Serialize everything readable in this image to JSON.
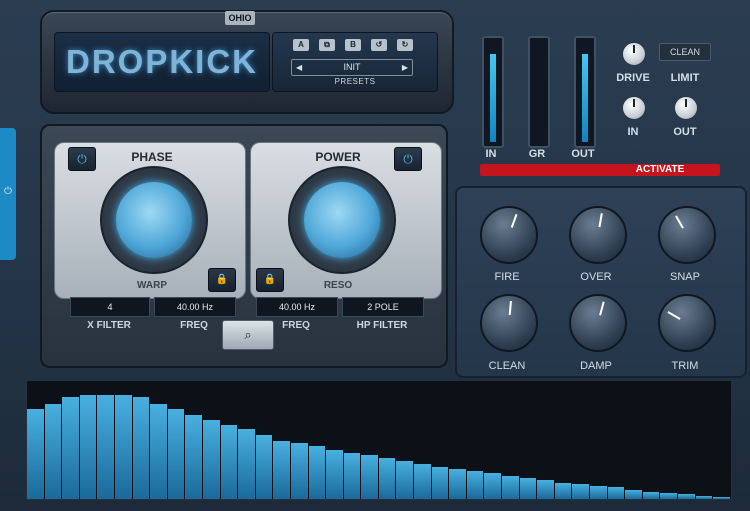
{
  "app": {
    "logo": "DROPKICK",
    "brand_badge": "OHIO"
  },
  "presets": {
    "buttons": [
      "A",
      "⧉",
      "B",
      "↺",
      "↻"
    ],
    "current": "INIT",
    "caption": "PRESETS"
  },
  "meters": [
    {
      "label": "IN",
      "level": 0.88
    },
    {
      "label": "GR",
      "level": 0.0
    },
    {
      "label": "OUT",
      "level": 0.88
    }
  ],
  "dynamics": {
    "mode": "CLEAN",
    "drive_label": "DRIVE",
    "limit_label": "LIMIT",
    "in_label": "IN",
    "out_label": "OUT"
  },
  "activate": {
    "label": "ACTIVATE",
    "color": "#c4141d"
  },
  "filters": {
    "left": {
      "title": "PHASE",
      "sub": "WARP",
      "values": [
        "4",
        "40.00 Hz"
      ],
      "labels": [
        "X FILTER",
        "FREQ"
      ]
    },
    "right": {
      "title": "POWER",
      "sub": "RESO",
      "values": [
        "40.00 Hz",
        "2 POLE"
      ],
      "labels": [
        "FREQ",
        "HP FILTER"
      ]
    }
  },
  "knob_bank": [
    {
      "label": "FIRE"
    },
    {
      "label": "OVER"
    },
    {
      "label": "SNAP"
    },
    {
      "label": "CLEAN"
    },
    {
      "label": "DAMP"
    },
    {
      "label": "TRIM"
    }
  ],
  "spectrum": {
    "levels": [
      0.78,
      0.82,
      0.88,
      0.9,
      0.9,
      0.9,
      0.88,
      0.82,
      0.78,
      0.72,
      0.68,
      0.64,
      0.6,
      0.55,
      0.5,
      0.48,
      0.46,
      0.42,
      0.4,
      0.38,
      0.35,
      0.33,
      0.3,
      0.28,
      0.26,
      0.24,
      0.22,
      0.2,
      0.18,
      0.16,
      0.14,
      0.13,
      0.11,
      0.1,
      0.08,
      0.06,
      0.05,
      0.04,
      0.03,
      0.02
    ],
    "accent": "#48b0e0"
  }
}
